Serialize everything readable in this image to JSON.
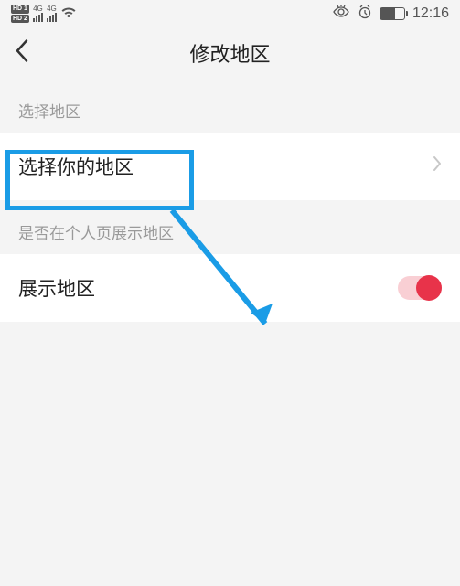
{
  "status_bar": {
    "hd1": "HD 1",
    "hd2": "HD 2",
    "sim1_net": "4G",
    "sim2_net": "4G",
    "time": "12:16"
  },
  "nav": {
    "title": "修改地区"
  },
  "section1": {
    "header": "选择地区",
    "row_label": "选择你的地区"
  },
  "section2": {
    "header": "是否在个人页展示地区",
    "row_label": "展示地区",
    "toggle_on": true
  }
}
